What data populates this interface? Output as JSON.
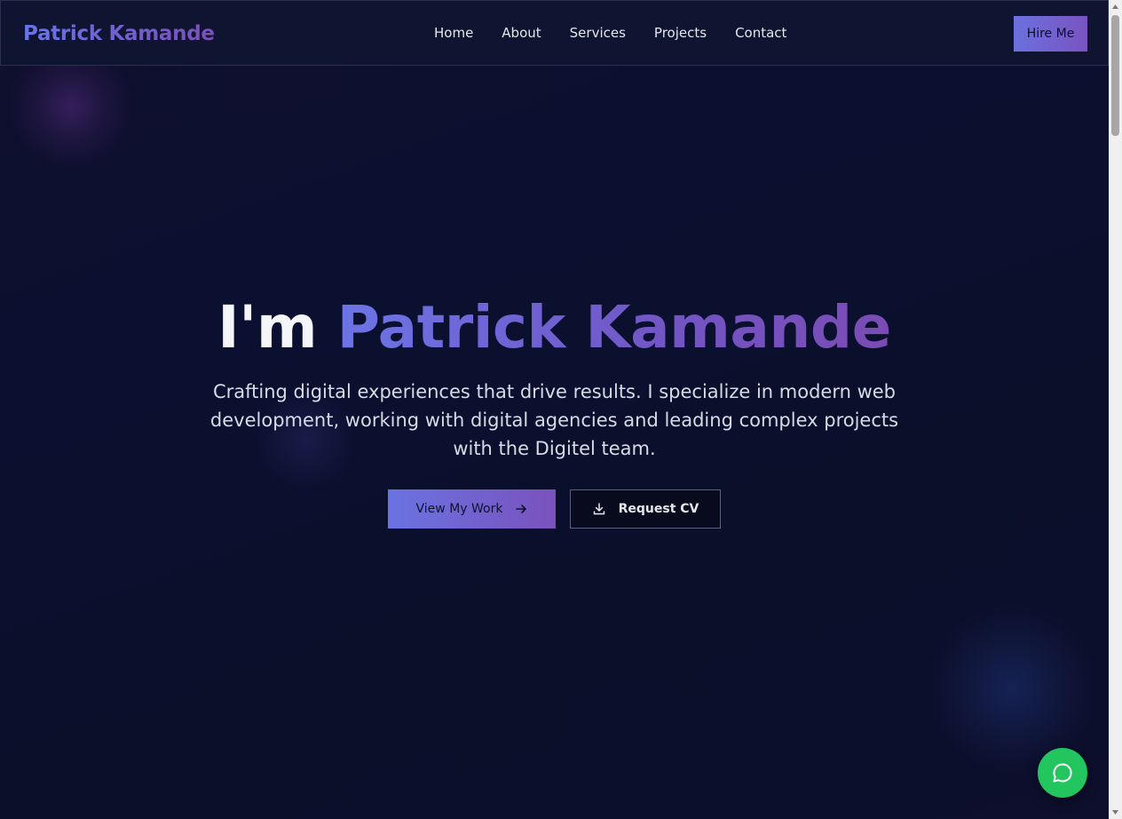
{
  "navbar": {
    "brand": "Patrick Kamande",
    "links": [
      "Home",
      "About",
      "Services",
      "Projects",
      "Contact"
    ],
    "cta_label": "Hire Me"
  },
  "hero": {
    "title_prefix": "I'm ",
    "title_name": "Patrick Kamande",
    "description": "Crafting digital experiences that drive results. I specialize in modern web development, working with digital agencies and leading complex projects with the Digitel team.",
    "primary_button": {
      "label": "View My Work",
      "icon": "arrow-right-icon"
    },
    "secondary_button": {
      "label": "Request CV",
      "icon": "download-icon"
    }
  },
  "chat": {
    "icon": "chat-bubble-icon"
  },
  "colors": {
    "background": "#0b1026",
    "accent_start": "#6a73e2",
    "accent_end": "#7a52bd",
    "chat_green": "#22c55e"
  }
}
